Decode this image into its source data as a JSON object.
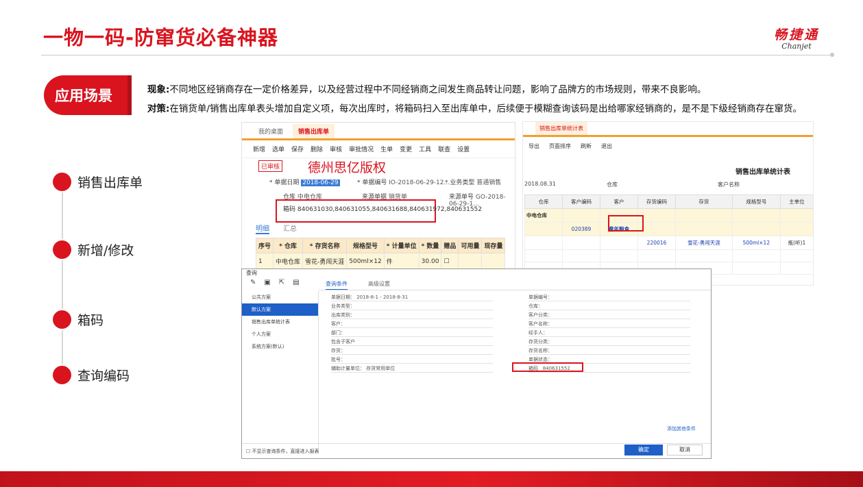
{
  "header": {
    "title": "一物一码-防窜货必备神器",
    "logo_cn": "畅捷通",
    "logo_en": "Chanjet"
  },
  "scene": {
    "badge": "应用场景"
  },
  "description": {
    "phenomenon_label": "现象:",
    "phenomenon_text": "不同地区经销商存在一定价格差异，以及经营过程中不同经销商之间发生商品转让问题，影响了品牌方的市场规则，带来不良影响。",
    "strategy_label": "对策:",
    "strategy_text": "在销货单/销售出库单表头增加自定义项，每次出库时，将箱码扫入至出库单中，后续便于模糊查询该码是出给哪家经销商的，是不是下级经销商存在窜货。"
  },
  "timeline": [
    "销售出库单",
    "新增/修改",
    "箱码",
    "查询编码"
  ],
  "shot1": {
    "tabs": [
      "我的桌面",
      "销售出库单"
    ],
    "toolbar": [
      "新增",
      "选单",
      "保存",
      "删除",
      "审核",
      "审批情况",
      "生单",
      "变更",
      "工具",
      "联查",
      "设置"
    ],
    "stamp": "已审核",
    "watermark": "德州思亿版权",
    "doc_date_label": "* 单据日期",
    "doc_date": "2018-06-29",
    "doc_no_label": "* 单据编号",
    "doc_no": "IO-2018-06-29-12...",
    "biz_type_label": "* 业务类型",
    "biz_type": "普通销售",
    "warehouse_label": "仓库",
    "warehouse": "中电仓库",
    "source_label": "来源单据",
    "source": "销货单",
    "source_no_label": "来源单号",
    "source_no": "GO-2018-06-29-1...",
    "box_code_label": "箱码",
    "box_code": "840631030,840631055,840631688,840631972,840631552",
    "subtabs": [
      "明细",
      "汇总"
    ],
    "columns": [
      "序号",
      "* 仓库",
      "* 存货名称",
      "规格型号",
      "* 计量单位",
      "* 数量",
      "赠品",
      "可用量",
      "现存量"
    ],
    "row": [
      "1",
      "中电仓库",
      "雪花-勇闯天涯",
      "500ml×12",
      "件",
      "30.00",
      "",
      "",
      ""
    ]
  },
  "shot2": {
    "tab": "销售出库单统计表",
    "toolbar": [
      "导出",
      "页面排序",
      "刷新",
      "退出"
    ],
    "report_title": "销售出库单统计表",
    "meta": [
      "2018.08.31",
      "仓库",
      "客户名称"
    ],
    "columns": [
      "仓库",
      "客户编码",
      "客户",
      "存货编码",
      "存货",
      "规格型号",
      "主单位"
    ],
    "row_warehouse": "中电仓库",
    "customer_code": "020389",
    "customer": "童年粮食",
    "item_code": "220016",
    "item": "雪花-勇闯天涯",
    "spec": "500ml×12",
    "unit": "瓶(听)1"
  },
  "shot3": {
    "title": "查询",
    "left_items": [
      "公共方案",
      "默认方案",
      "销售出库单统计表",
      "个人方案",
      "系统方案(默认)"
    ],
    "tabs": [
      "查询条件",
      "高级设置"
    ],
    "fields_left": [
      "单据日期：  2018-8-1    -   2018-8-31",
      "业务类型：",
      "出库类别：",
      "客户：",
      "部门：",
      "包含子客户",
      "存货：",
      "批号：",
      "辅助计量单位：  存货常用单位"
    ],
    "fields_right": [
      "单据编号：",
      "仓库：",
      "客户分类：",
      "客户名称：",
      "经手人：",
      "存货分类：",
      "存货名称：",
      "单据状态："
    ],
    "box_code_label": "箱码",
    "box_code": "840631552",
    "add_condition": "添加其他条件",
    "footer_note": "不显示查询条件，直接进入报表",
    "ok": "确定",
    "cancel": "取消"
  },
  "colors": {
    "accent": "#d9141e",
    "blue": "#1e5fc8",
    "orange": "#f0a030"
  }
}
